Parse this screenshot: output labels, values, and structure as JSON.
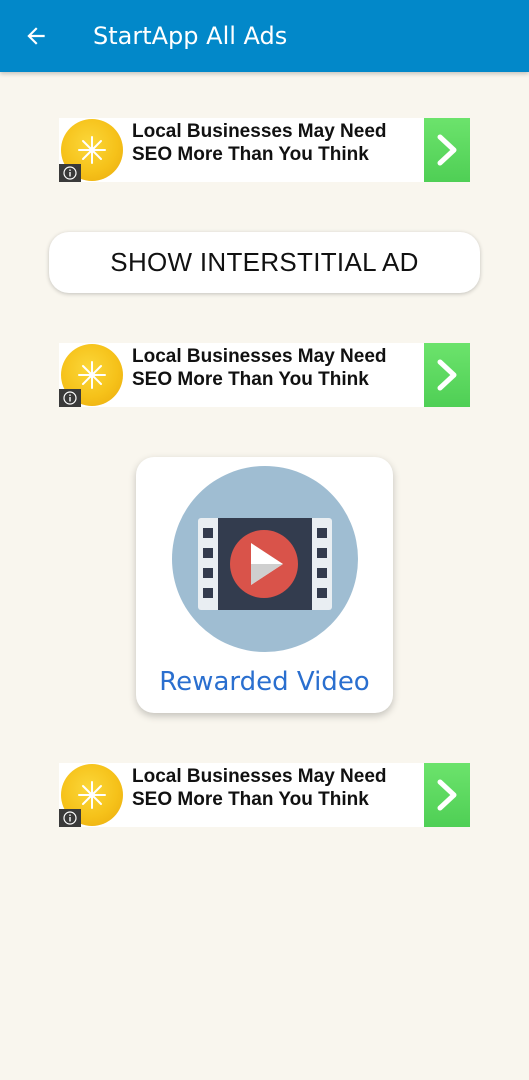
{
  "appbar": {
    "title": "StartApp All Ads",
    "background_color": "#0288c9",
    "back_icon": "arrow-left-icon"
  },
  "banners": [
    {
      "text_line1": "Local Businesses May Need",
      "text_line2": "SEO More Than You Think",
      "logo_icon": "yellow-flower-logo",
      "info_icon": "info-icon",
      "arrow_icon": "chevron-right-icon"
    },
    {
      "text_line1": "Local Businesses May Need",
      "text_line2": "SEO More Than You Think",
      "logo_icon": "yellow-flower-logo",
      "info_icon": "info-icon",
      "arrow_icon": "chevron-right-icon"
    },
    {
      "text_line1": "Local Businesses May Need",
      "text_line2": "SEO More Than You Think",
      "logo_icon": "yellow-flower-logo",
      "info_icon": "info-icon",
      "arrow_icon": "chevron-right-icon"
    }
  ],
  "interstitial_button": {
    "label": "SHOW INTERSTITIAL AD"
  },
  "rewarded_video": {
    "label": "Rewarded Video",
    "icon": "video-play-icon",
    "label_color": "#2a6fcf"
  },
  "colors": {
    "page_background": "#f9f6ee",
    "ad_arrow_green": "#5bd85d"
  }
}
